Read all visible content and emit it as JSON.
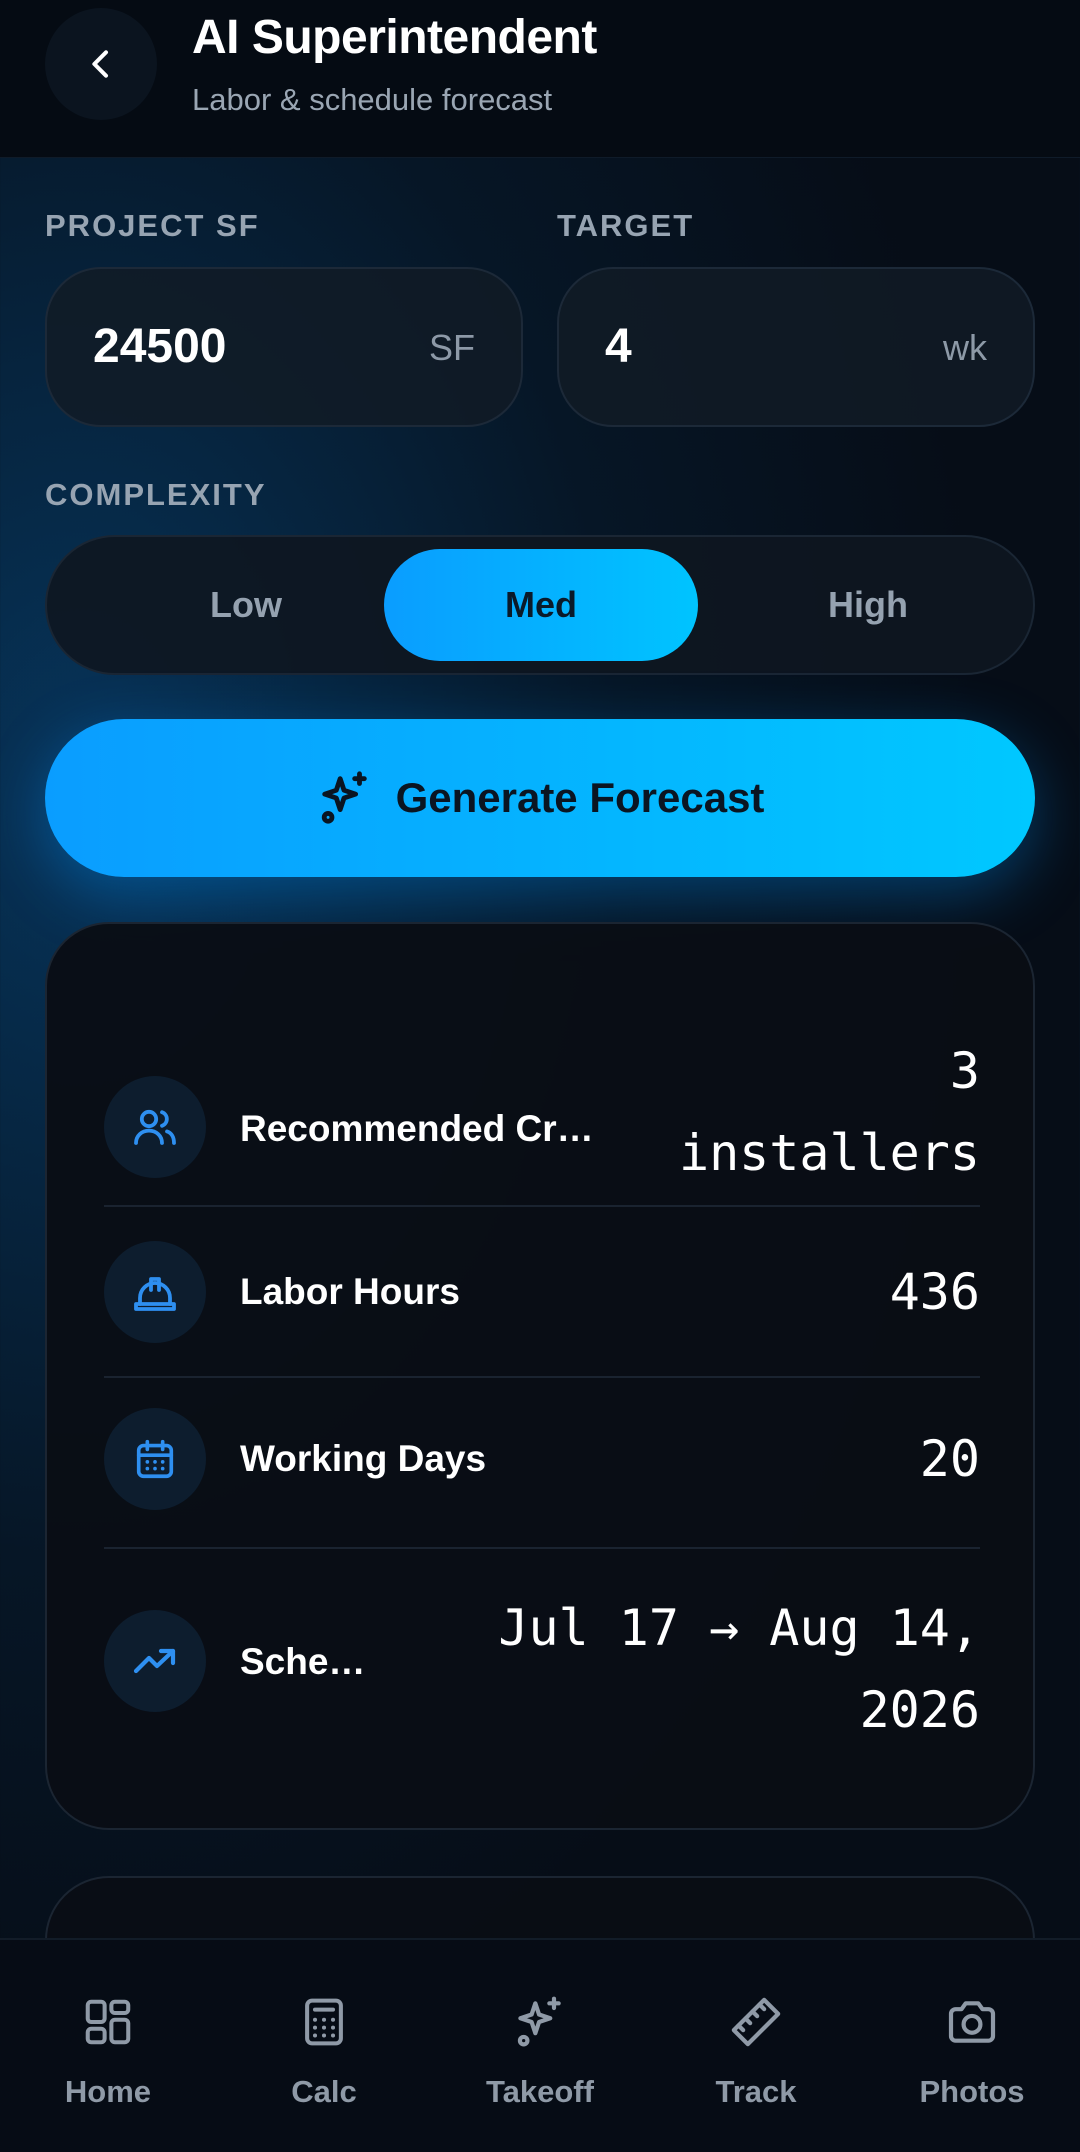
{
  "header": {
    "title": "AI Superintendent",
    "subtitle": "Labor & schedule forecast"
  },
  "form": {
    "project_sf_label": "PROJECT SF",
    "project_sf_value": "24500",
    "project_sf_unit": "SF",
    "target_label": "TARGET",
    "target_value": "4",
    "target_unit": "wk",
    "complexity_label": "COMPLEXITY",
    "complexity_options": [
      "Low",
      "Med",
      "High"
    ],
    "complexity_selected": "Med"
  },
  "actions": {
    "generate_label": "Generate Forecast"
  },
  "results": [
    {
      "label": "Recommended Cr…",
      "value_line1": "3",
      "value_line2": "installers",
      "icon": "users-icon"
    },
    {
      "label": "Labor Hours",
      "value_line1": "436",
      "icon": "hard-hat-icon"
    },
    {
      "label": "Working Days",
      "value_line1": "20",
      "icon": "calendar-icon"
    },
    {
      "label": "Sche…",
      "value_line1": "Jul 17 → Aug 14,",
      "value_line2": "2026",
      "icon": "trending-up-icon"
    }
  ],
  "nav": [
    {
      "label": "Home",
      "icon": "grid-icon"
    },
    {
      "label": "Calc",
      "icon": "calculator-icon"
    },
    {
      "label": "Takeoff",
      "icon": "sparkles-icon"
    },
    {
      "label": "Track",
      "icon": "ruler-icon"
    },
    {
      "label": "Photos",
      "icon": "camera-icon"
    }
  ],
  "colors": {
    "accent": "#0a9dff",
    "accent_end": "#00c4ff",
    "icon_blue": "#2e8ff0",
    "background": "#060d17"
  }
}
